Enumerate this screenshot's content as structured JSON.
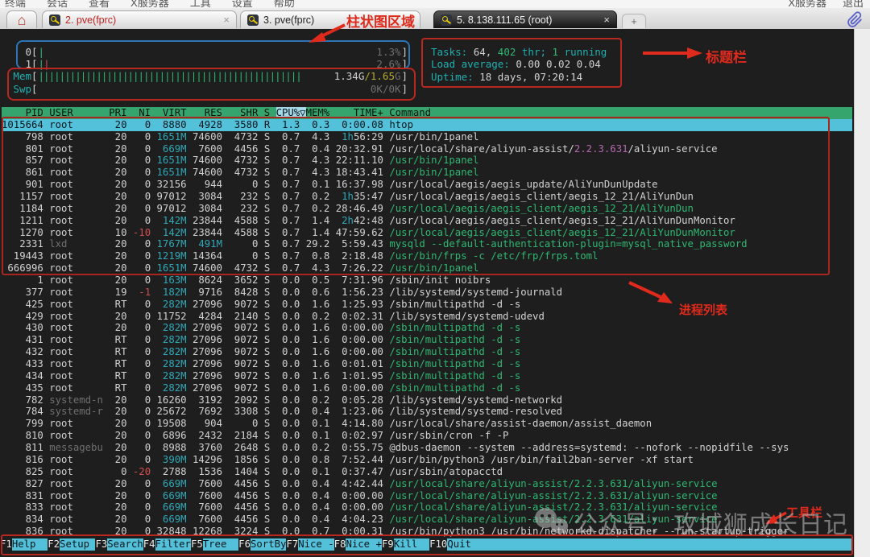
{
  "menu": {
    "items": [
      "终端",
      "会话",
      "查看",
      "X服务器",
      "工具",
      "设置",
      "帮助"
    ],
    "right_items": [
      "X服务器",
      "退出"
    ]
  },
  "tabs": {
    "list": [
      {
        "label": "2. pve(fprc)"
      },
      {
        "label": "3. pve(fprc)"
      },
      {
        "label": "5. 8.138.111.65 (root)",
        "active": true
      }
    ],
    "close_label": "×",
    "new_tab_label": "+"
  },
  "htop": {
    "meters": [
      {
        "label": "0",
        "label_color": "w",
        "ticks": [
          [
            "|",
            "g"
          ]
        ],
        "value_segs": [
          [
            "1.3%",
            "d"
          ]
        ]
      },
      {
        "label": "1",
        "label_color": "w",
        "ticks": [
          [
            "|",
            "g"
          ],
          [
            "|",
            "r"
          ]
        ],
        "value_segs": [
          [
            "2.6%",
            "d"
          ]
        ]
      },
      {
        "label": "Mem",
        "label_color": "c",
        "fill_chars": 50,
        "value_segs": [
          [
            "1.34G",
            "w"
          ],
          [
            "/1.65",
            "y"
          ],
          [
            "G",
            "d"
          ]
        ]
      },
      {
        "label": "Swp",
        "label_color": "c",
        "fill_chars": 0,
        "value_segs": [
          [
            "0K/0K",
            "d"
          ]
        ]
      }
    ],
    "tasks_line": [
      [
        "Tasks: ",
        "c"
      ],
      [
        "64, ",
        "w"
      ],
      [
        "402",
        "g"
      ],
      [
        " thr; ",
        "c"
      ],
      [
        "1",
        "g"
      ],
      [
        " running",
        "c"
      ]
    ],
    "load_line": [
      [
        "Load average: ",
        "c"
      ],
      [
        "0.00 ",
        "w"
      ],
      [
        "0.02 ",
        "w"
      ],
      [
        "0.04",
        "w"
      ]
    ],
    "uptime_line": [
      [
        "Uptime: ",
        "c"
      ],
      [
        "18 days, 07:20:14",
        "w"
      ]
    ],
    "header_segments": [
      [
        "    PID USER      PRI  NI  VIRT   RES   SHR S ",
        "hdr"
      ],
      [
        "CPU%▽",
        "hdrsort"
      ],
      [
        "MEM%    TIME+ Command",
        "hdr"
      ]
    ],
    "rows": [
      [
        "1015664",
        "root",
        "20",
        "0",
        "8880",
        "4928",
        "3580",
        "R",
        "1.3",
        "0.3",
        "0:00.08",
        [
          [
            "htop",
            "w"
          ]
        ],
        1
      ],
      [
        "798",
        "root",
        "20",
        "0",
        "1651M",
        "74600",
        "4732",
        "S",
        "0.7",
        "4.3",
        "1h56:29",
        [
          [
            "/usr/bin/1panel",
            "w"
          ]
        ]
      ],
      [
        "801",
        "root",
        "20",
        "0",
        "669M",
        "7600",
        "4456",
        "S",
        "0.7",
        "0.4",
        "20:32.91",
        [
          [
            "/usr/local/share/aliyun-assist/",
            "w"
          ],
          [
            "2.2.3.631",
            "m"
          ],
          [
            "/aliyun-service",
            "w"
          ]
        ]
      ],
      [
        "857",
        "root",
        "20",
        "0",
        "1651M",
        "74600",
        "4732",
        "S",
        "0.7",
        "4.3",
        "22:11.10",
        [
          [
            "/usr/bin/1panel",
            "g"
          ]
        ]
      ],
      [
        "861",
        "root",
        "20",
        "0",
        "1651M",
        "74600",
        "4732",
        "S",
        "0.7",
        "4.3",
        "18:43.41",
        [
          [
            "/usr/bin/1panel",
            "g"
          ]
        ]
      ],
      [
        "901",
        "root",
        "20",
        "0",
        "32156",
        "944",
        "0",
        "S",
        "0.7",
        "0.1",
        "16:37.98",
        [
          [
            "/usr/local/aegis/aegis_update/AliYunDunUpdate",
            "w"
          ]
        ]
      ],
      [
        "1157",
        "root",
        "20",
        "0",
        "97012",
        "3084",
        "232",
        "S",
        "0.7",
        "0.2",
        "1h35:47",
        [
          [
            "/usr/local/aegis/aegis_client/aegis_12_21/AliYunDun",
            "w"
          ]
        ]
      ],
      [
        "1184",
        "root",
        "20",
        "0",
        "97012",
        "3084",
        "232",
        "S",
        "0.7",
        "0.2",
        "28:46.49",
        [
          [
            "/usr/local/aegis/aegis_client/aegis_12_21/AliYunDun",
            "g"
          ]
        ]
      ],
      [
        "1211",
        "root",
        "20",
        "0",
        "142M",
        "23844",
        "4588",
        "S",
        "0.7",
        "1.4",
        "2h42:48",
        [
          [
            "/usr/local/aegis/aegis_client/aegis_12_21/AliYunDunMonitor",
            "w"
          ]
        ]
      ],
      [
        "1270",
        "root",
        "10",
        "-10",
        "142M",
        "23844",
        "4588",
        "S",
        "0.7",
        "1.4",
        "47:59.62",
        [
          [
            "/usr/local/aegis/aegis_client/aegis_12_21/AliYunDunMonitor",
            "g"
          ]
        ]
      ],
      [
        "2331",
        "lxd",
        "20",
        "0",
        "1767M",
        "491M",
        "0",
        "S",
        "0.7",
        "29.2",
        "5:59.43",
        [
          [
            "mysqld --default-authentication-plugin=mysql_native_password",
            "g"
          ]
        ]
      ],
      [
        "19443",
        "root",
        "20",
        "0",
        "1219M",
        "14364",
        "0",
        "S",
        "0.7",
        "0.8",
        "2:18.48",
        [
          [
            "/usr/bin/frps -c /etc/frp/frps.toml",
            "g"
          ]
        ]
      ],
      [
        "666996",
        "root",
        "20",
        "0",
        "1651M",
        "74600",
        "4732",
        "S",
        "0.7",
        "4.3",
        "7:26.22",
        [
          [
            "/usr/bin/1panel",
            "g"
          ]
        ]
      ],
      [
        "1",
        "root",
        "20",
        "0",
        "163M",
        "8624",
        "3652",
        "S",
        "0.0",
        "0.5",
        "7:31.96",
        [
          [
            "/sbin/init noibrs",
            "w"
          ]
        ]
      ],
      [
        "377",
        "root",
        "19",
        "-1",
        "182M",
        "9716",
        "8428",
        "S",
        "0.0",
        "0.6",
        "1:56.23",
        [
          [
            "/lib/systemd/systemd-journald",
            "w"
          ]
        ]
      ],
      [
        "425",
        "root",
        "RT",
        "0",
        "282M",
        "27096",
        "9072",
        "S",
        "0.0",
        "1.6",
        "1:25.93",
        [
          [
            "/sbin/multipathd -d -s",
            "w"
          ]
        ]
      ],
      [
        "429",
        "root",
        "20",
        "0",
        "11752",
        "4284",
        "2140",
        "S",
        "0.0",
        "0.2",
        "0:02.31",
        [
          [
            "/lib/systemd/systemd-udevd",
            "w"
          ]
        ]
      ],
      [
        "430",
        "root",
        "20",
        "0",
        "282M",
        "27096",
        "9072",
        "S",
        "0.0",
        "1.6",
        "0:00.00",
        [
          [
            "/sbin/multipathd -d -s",
            "g"
          ]
        ]
      ],
      [
        "431",
        "root",
        "RT",
        "0",
        "282M",
        "27096",
        "9072",
        "S",
        "0.0",
        "1.6",
        "0:00.00",
        [
          [
            "/sbin/multipathd -d -s",
            "g"
          ]
        ]
      ],
      [
        "432",
        "root",
        "RT",
        "0",
        "282M",
        "27096",
        "9072",
        "S",
        "0.0",
        "1.6",
        "0:00.00",
        [
          [
            "/sbin/multipathd -d -s",
            "g"
          ]
        ]
      ],
      [
        "433",
        "root",
        "RT",
        "0",
        "282M",
        "27096",
        "9072",
        "S",
        "0.0",
        "1.6",
        "0:01.01",
        [
          [
            "/sbin/multipathd -d -s",
            "g"
          ]
        ]
      ],
      [
        "434",
        "root",
        "RT",
        "0",
        "282M",
        "27096",
        "9072",
        "S",
        "0.0",
        "1.6",
        "1:01.95",
        [
          [
            "/sbin/multipathd -d -s",
            "g"
          ]
        ]
      ],
      [
        "435",
        "root",
        "RT",
        "0",
        "282M",
        "27096",
        "9072",
        "S",
        "0.0",
        "1.6",
        "0:00.00",
        [
          [
            "/sbin/multipathd -d -s",
            "g"
          ]
        ]
      ],
      [
        "782",
        "systemd-n",
        "20",
        "0",
        "16260",
        "3192",
        "2092",
        "S",
        "0.0",
        "0.2",
        "0:05.28",
        [
          [
            "/lib/systemd/systemd-networkd",
            "w"
          ]
        ]
      ],
      [
        "784",
        "systemd-r",
        "20",
        "0",
        "25672",
        "7692",
        "3308",
        "S",
        "0.0",
        "0.4",
        "1:23.06",
        [
          [
            "/lib/systemd/systemd-resolved",
            "w"
          ]
        ]
      ],
      [
        "799",
        "root",
        "20",
        "0",
        "19508",
        "904",
        "0",
        "S",
        "0.0",
        "0.1",
        "4:14.80",
        [
          [
            "/usr/local/share/assist-daemon/assist_daemon",
            "w"
          ]
        ]
      ],
      [
        "810",
        "root",
        "20",
        "0",
        "6896",
        "2432",
        "2184",
        "S",
        "0.0",
        "0.1",
        "0:02.97",
        [
          [
            "/usr/sbin/cron -f -P",
            "w"
          ]
        ]
      ],
      [
        "811",
        "messagebu",
        "20",
        "0",
        "8988",
        "3760",
        "2648",
        "S",
        "0.0",
        "0.2",
        "0:55.75",
        [
          [
            "@dbus-daemon --system --address=systemd: --nofork --nopidfile --sys",
            "w"
          ]
        ]
      ],
      [
        "816",
        "root",
        "20",
        "0",
        "390M",
        "14296",
        "1856",
        "S",
        "0.0",
        "0.8",
        "7:52.44",
        [
          [
            "/usr/bin/python3 /usr/bin/fail2ban-server -xf start",
            "w"
          ]
        ]
      ],
      [
        "825",
        "root",
        "0",
        "-20",
        "2788",
        "1536",
        "1404",
        "S",
        "0.0",
        "0.1",
        "0:37.47",
        [
          [
            "/usr/sbin/atopacctd",
            "w"
          ]
        ]
      ],
      [
        "827",
        "root",
        "20",
        "0",
        "669M",
        "7600",
        "4456",
        "S",
        "0.0",
        "0.4",
        "4:42.44",
        [
          [
            "/usr/local/share/aliyun-assist/2.2.3.631/aliyun-service",
            "g"
          ]
        ]
      ],
      [
        "831",
        "root",
        "20",
        "0",
        "669M",
        "7600",
        "4456",
        "S",
        "0.0",
        "0.4",
        "0:00.00",
        [
          [
            "/usr/local/share/aliyun-assist/2.2.3.631/aliyun-service",
            "g"
          ]
        ]
      ],
      [
        "833",
        "root",
        "20",
        "0",
        "669M",
        "7600",
        "4456",
        "S",
        "0.0",
        "0.4",
        "0:00.00",
        [
          [
            "/usr/local/share/aliyun-assist/2.2.3.631/aliyun-service",
            "g"
          ]
        ]
      ],
      [
        "834",
        "root",
        "20",
        "0",
        "669M",
        "7600",
        "4456",
        "S",
        "0.0",
        "0.4",
        "4:04.23",
        [
          [
            "/usr/local/share/aliyun-assist/2.2.3.631/aliyun-service",
            "g"
          ]
        ]
      ],
      [
        "836",
        "root",
        "20",
        "0",
        "32848",
        "12268",
        "3224",
        "S",
        "0.0",
        "0.7",
        "0:00.31",
        [
          [
            "/usr/bin/python3 /usr/bin/networkd-dispatcher --run-startup-trigger",
            "w"
          ]
        ]
      ]
    ],
    "fnkeys": [
      [
        "F1",
        "Help  "
      ],
      [
        "F2",
        "Setup "
      ],
      [
        "F3",
        "Search"
      ],
      [
        "F4",
        "Filter"
      ],
      [
        "F5",
        "Tree  "
      ],
      [
        "F6",
        "SortBy"
      ],
      [
        "F7",
        "Nice -"
      ],
      [
        "F8",
        "Nice +"
      ],
      [
        "F9",
        "Kill  "
      ],
      [
        "F10",
        "Quit  "
      ]
    ]
  },
  "annotations": {
    "chart_area": "柱状图区域",
    "title_bar": "标题栏",
    "process_list": "进程列表",
    "toolbar": "工具栏"
  },
  "watermark": {
    "text": "公众号：攻城狮成长日记"
  },
  "colors": {
    "terminal_bg": "#1e1e1e",
    "header_bg": "#35a56d",
    "sort_column_bg": "#a6d9e8",
    "selected_row_bg": "#53c1da",
    "function_bar_bg": "#53c1da",
    "annotation_red": "#e02a1c",
    "annotation_blue": "#2e75b6",
    "cmd_green": "#2eb872",
    "size_teal": "#2fa8b8",
    "version_magenta": "#b468b0"
  }
}
